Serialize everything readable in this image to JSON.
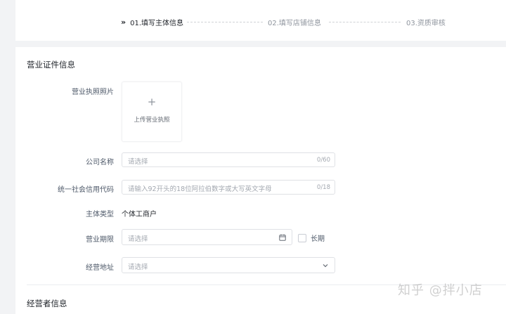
{
  "steps": [
    {
      "label": "01.填写主体信息",
      "active": true
    },
    {
      "label": "02.填写店铺信息",
      "active": false
    },
    {
      "label": "03.资质审核",
      "active": false
    }
  ],
  "business_license_section": {
    "title": "营业证件信息",
    "license_photo": {
      "label": "营业执照照片",
      "upload_text": "上传营业执照",
      "plus": "+"
    },
    "company_name": {
      "label": "公司名称",
      "placeholder": "请选择",
      "count": "0/60"
    },
    "credit_code": {
      "label": "统一社会信用代码",
      "placeholder": "请输入92开头的18位阿拉伯数字或大写英文字母",
      "count": "0/18"
    },
    "entity_type": {
      "label": "主体类型",
      "value": "个体工商户"
    },
    "business_term": {
      "label": "营业期限",
      "placeholder": "请选择",
      "icon": "calendar-icon",
      "long_term_label": "长期"
    },
    "business_address": {
      "label": "经营地址",
      "placeholder": "请选择",
      "icon": "chevron-down-icon"
    }
  },
  "operator_section": {
    "title": "经营者信息"
  },
  "watermark": "知乎 @拌小店"
}
